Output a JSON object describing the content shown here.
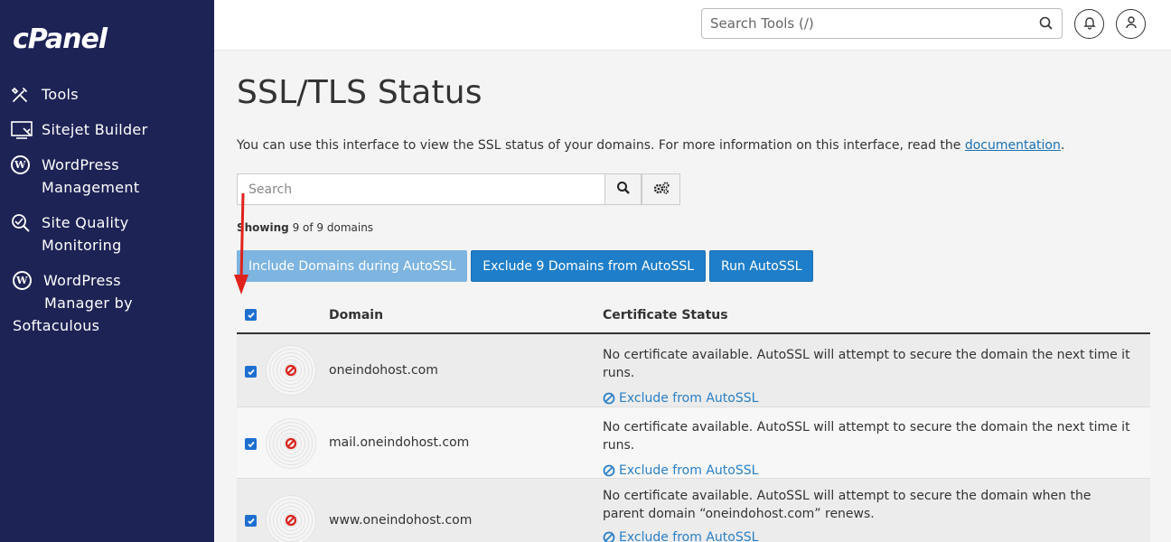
{
  "app": {
    "logo": "cPanel"
  },
  "sidebar": {
    "items": [
      {
        "label": "Tools",
        "icon": "tools-icon"
      },
      {
        "label": "Sitejet Builder",
        "icon": "sitejet-icon"
      },
      {
        "label_line1": "WordPress",
        "label_line2": "Management",
        "icon": "wordpress-icon"
      },
      {
        "label_line1": "Site Quality",
        "label_line2": "Monitoring",
        "icon": "site-quality-icon"
      },
      {
        "label_line1": "WordPress",
        "label_line2": "Manager by",
        "label_line3": "Softaculous",
        "icon": "wordpress-icon"
      }
    ]
  },
  "header": {
    "search_placeholder": "Search Tools (/)",
    "notifications_icon": "bell-icon",
    "user_icon": "user-icon"
  },
  "page": {
    "title": "SSL/TLS Status",
    "description": "You can use this interface to view the SSL status of your domains. For more information on this interface, read the ",
    "description_link": "documentation",
    "description_end": ".",
    "search_placeholder": "Search",
    "showing_bold": "Showing",
    "showing_rest": " 9 of 9 domains",
    "buttons": {
      "include": "Include Domains during AutoSSL",
      "exclude_all": "Exclude 9 Domains from AutoSSL",
      "run": "Run AutoSSL"
    },
    "table": {
      "headers": {
        "domain": "Domain",
        "status": "Certificate Status"
      },
      "exclude_label": "Exclude from AutoSSL",
      "rows": [
        {
          "domain": "oneindohost.com",
          "status": "No certificate available. AutoSSL will attempt to secure the domain the next time it runs.",
          "checked": true
        },
        {
          "domain": "mail.oneindohost.com",
          "status": "No certificate available. AutoSSL will attempt to secure the domain the next time it runs.",
          "checked": true
        },
        {
          "domain": "www.oneindohost.com",
          "status": "No certificate available. AutoSSL will attempt to secure the domain when the parent domain “oneindohost.com” renews.",
          "checked": true
        }
      ]
    }
  },
  "colors": {
    "sidebar_bg": "#1e2355",
    "primary_button": "#1f7ec9",
    "disabled_button": "#7db4e0",
    "link": "#1a6fb5",
    "error_icon": "#d9251c",
    "annotation_arrow": "#e0231c"
  }
}
